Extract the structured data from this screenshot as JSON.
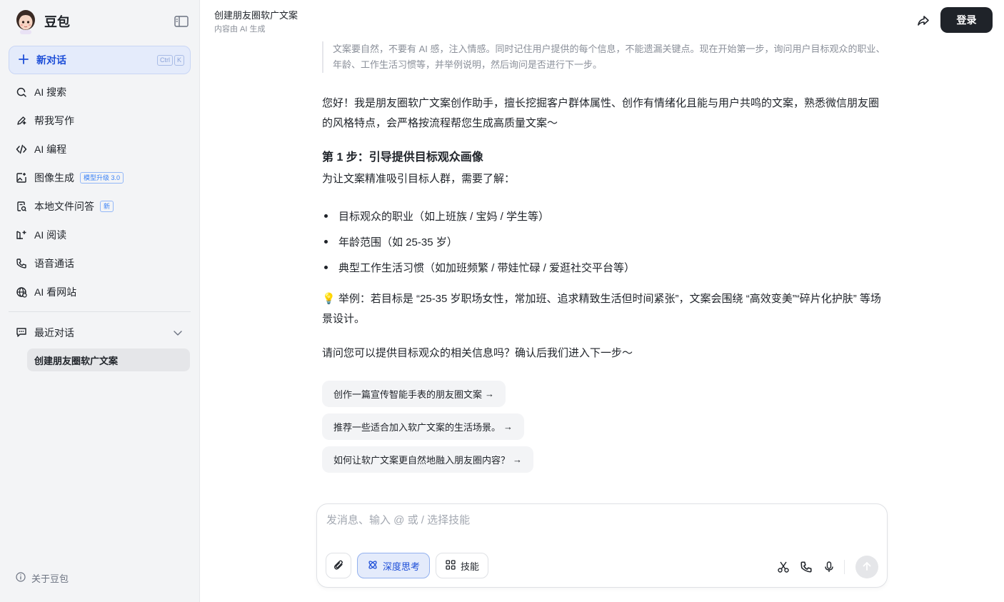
{
  "sidebar": {
    "brand": "豆包",
    "new_chat": {
      "label": "新对话",
      "shortcut": [
        "Ctrl",
        "K"
      ]
    },
    "items": [
      {
        "label": "AI 搜索",
        "icon": "search-icon"
      },
      {
        "label": "帮我写作",
        "icon": "pen-icon"
      },
      {
        "label": "AI 编程",
        "icon": "code-icon"
      },
      {
        "label": "图像生成",
        "icon": "image-icon",
        "badge": "模型升级 3.0"
      },
      {
        "label": "本地文件问答",
        "icon": "file-icon",
        "badge": "新"
      },
      {
        "label": "AI 阅读",
        "icon": "read-icon"
      },
      {
        "label": "语音通话",
        "icon": "phone-icon"
      },
      {
        "label": "AI 看网站",
        "icon": "globe-icon"
      }
    ],
    "recent": {
      "label": "最近对话",
      "items": [
        "创建朋友圈软广文案"
      ]
    },
    "about": "关于豆包"
  },
  "header": {
    "title": "创建朋友圈软广文案",
    "subtitle": "内容由 AI 生成",
    "login": "登录"
  },
  "conversation": {
    "quote": "文案要自然，不要有 AI 感，注入情感。同时记住用户提供的每个信息，不能遗漏关键点。现在开始第一步，询问用户目标观众的职业、年龄、工作生活习惯等，并举例说明，然后询问是否进行下一步。",
    "intro": "您好！我是朋友圈软广文案创作助手，擅长挖掘客户群体属性、创作有情绪化且能与用户共鸣的文案，熟悉微信朋友圈的风格特点，会严格按流程帮您生成高质量文案～",
    "step_title": "第 1 步：引导提供目标观众画像",
    "step_lead": "为让文案精准吸引目标人群，需要了解：",
    "bullets": [
      "目标观众的职业（如上班族 / 宝妈 / 学生等）",
      "年龄范围（如 25-35 岁）",
      "典型工作生活习惯（如加班频繁 / 带娃忙碌 / 爱逛社交平台等）"
    ],
    "example": "💡 举例：若目标是 “25-35 岁职场女性，常加班、追求精致生活但时间紧张”，文案会围绕 “高效变美”“碎片化护肤” 等场景设计。",
    "question": "请问您可以提供目标观众的相关信息吗？确认后我们进入下一步～",
    "suggestions": [
      "创作一篇宣传智能手表的朋友圈文案",
      "推荐一些适合加入软广文案的生活场景。",
      "如何让软广文案更自然地融入朋友圈内容？"
    ],
    "arrow": "→"
  },
  "composer": {
    "placeholder": "发消息、输入 @ 或 / 选择技能",
    "value": "",
    "deep_think": "深度思考",
    "skills": "技能"
  },
  "colors": {
    "accent": "#1d4ed8",
    "accent_bg": "#e4ebfb",
    "sidebar_bg": "#f3f4f6",
    "dark_button": "#1f2329"
  }
}
